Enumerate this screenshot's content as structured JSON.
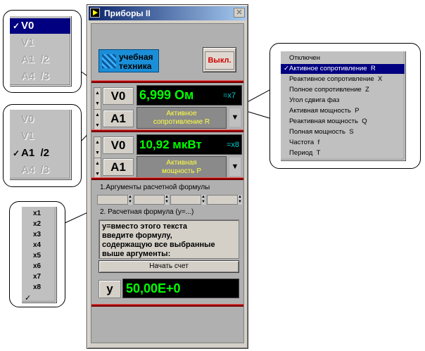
{
  "window": {
    "title": "Приборы  II"
  },
  "logo": {
    "line1": "учебная",
    "line2": "техника"
  },
  "power_button": {
    "label": "Выкл."
  },
  "channel1": {
    "volt_label": "V0",
    "value": "6,999 Ом",
    "multiplier": "=x7",
    "func_label": "A1",
    "func_line1": "Активное",
    "func_line2": "сопротивление  R"
  },
  "channel2": {
    "volt_label": "V0",
    "value": "10,92 мкВт",
    "multiplier": "=x8",
    "func_label": "A1",
    "func_line1": "Активная",
    "func_line2": "мощность  P"
  },
  "formula": {
    "args_title": "1.Аргументы расчетной формулы",
    "formula_title": "2. Расчетная формула (y=...)",
    "text_lines": [
      "y=вместо этого текста",
      "введите формулу,",
      "содержащую все выбранные",
      "выше аргументы:"
    ],
    "start_button": "Начать счет",
    "result_label": "y",
    "result_value": "50,00E+0"
  },
  "callout_voltage": {
    "items": [
      {
        "label": "V0",
        "checked": true,
        "selected": true,
        "enabled": true
      },
      {
        "label": "V1",
        "checked": false,
        "selected": false,
        "enabled": false
      },
      {
        "label": "A1  /2",
        "checked": false,
        "selected": false,
        "enabled": false
      },
      {
        "label": "A4  /3",
        "checked": false,
        "selected": false,
        "enabled": false
      }
    ]
  },
  "callout_current": {
    "items": [
      {
        "label": "V0",
        "checked": false,
        "selected": false,
        "enabled": false
      },
      {
        "label": "V1",
        "checked": false,
        "selected": false,
        "enabled": false
      },
      {
        "label": "A1  /2",
        "checked": true,
        "selected": false,
        "enabled": true
      },
      {
        "label": "A4  /3",
        "checked": false,
        "selected": false,
        "enabled": false
      }
    ]
  },
  "callout_multiplier": {
    "items": [
      "x1",
      "x2",
      "x3",
      "x4",
      "x5",
      "x6",
      "x7",
      "x8"
    ],
    "checkmark": "✓"
  },
  "callout_functions": {
    "items": [
      {
        "label": "Отключен",
        "selected": false
      },
      {
        "label": "Активное сопротивление  R",
        "selected": true
      },
      {
        "label": "Реактивное сопротивление  X",
        "selected": false
      },
      {
        "label": "Полное сопротивление  Z",
        "selected": false
      },
      {
        "label": "Угол сдвига фаз",
        "selected": false
      },
      {
        "label": "Активная мощность  P",
        "selected": false
      },
      {
        "label": "Реактивная мощность  Q",
        "selected": false
      },
      {
        "label": "Полная мощность  S",
        "selected": false
      },
      {
        "label": "Частота  f",
        "selected": false
      },
      {
        "label": "Период  T",
        "selected": false
      }
    ],
    "checkmark": "✓"
  }
}
